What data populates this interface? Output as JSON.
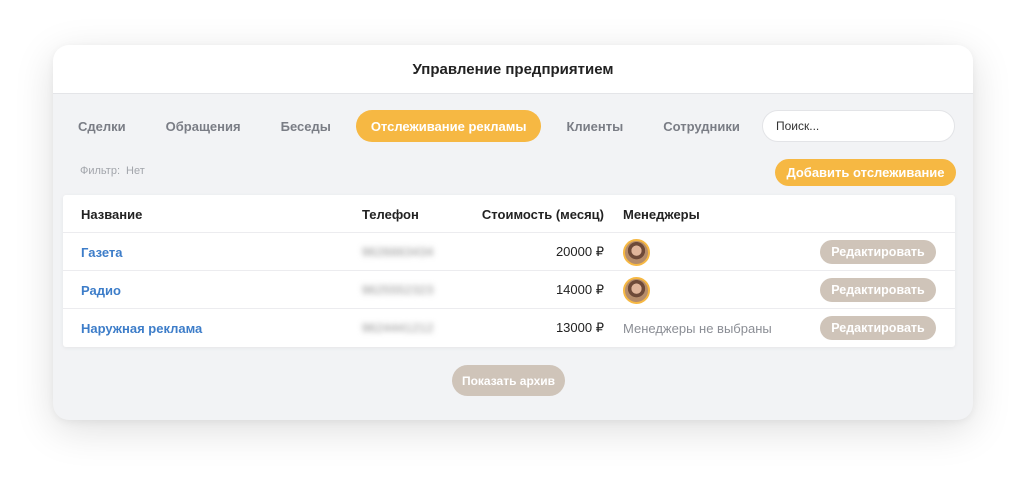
{
  "window": {
    "title": "Управление предприятием"
  },
  "tabs": [
    {
      "label": "Сделки",
      "active": false
    },
    {
      "label": "Обращения",
      "active": false
    },
    {
      "label": "Беседы",
      "active": false
    },
    {
      "label": "Отслеживание рекламы",
      "active": true
    },
    {
      "label": "Клиенты",
      "active": false
    },
    {
      "label": "Сотрудники",
      "active": false
    }
  ],
  "search": {
    "placeholder": "Поиск..."
  },
  "filter": {
    "label": "Фильтр:",
    "value": "Нет"
  },
  "toolbar": {
    "add_label": "Добавить отслеживание"
  },
  "table": {
    "headers": {
      "name": "Название",
      "phone": "Телефон",
      "cost": "Стоимость (месяц)",
      "managers": "Менеджеры"
    },
    "rows": [
      {
        "name": "Газета",
        "phone": "9626663434",
        "cost": "20000 ₽",
        "managers": "",
        "has_avatar": true,
        "edit_label": "Редактировать"
      },
      {
        "name": "Радио",
        "phone": "9625552323",
        "cost": "14000 ₽",
        "managers": "",
        "has_avatar": true,
        "edit_label": "Редактировать"
      },
      {
        "name": "Наружная реклама",
        "phone": "9624441212",
        "cost": "13000 ₽",
        "managers": "Менеджеры не выбраны",
        "has_avatar": false,
        "edit_label": "Редактировать"
      }
    ]
  },
  "footer": {
    "archive_label": "Показать архив"
  },
  "colors": {
    "accent": "#f6b843",
    "link": "#3d7dc9",
    "muted_button": "#cfc4b9"
  }
}
